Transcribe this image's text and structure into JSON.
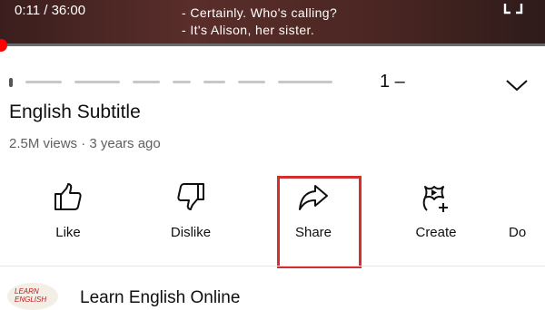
{
  "player": {
    "time_display": "0:11 / 36:00",
    "subtitles": [
      "- Certainly. Who's calling?",
      "- It's Alison, her sister."
    ],
    "progress_fraction": 0.005
  },
  "video": {
    "title_suffix": "1 –",
    "subtitle_line": "English Subtitle",
    "meta": "2.5M views · 3 years ago"
  },
  "actions": [
    {
      "label": "Like",
      "icon": "thumbs-up-icon"
    },
    {
      "label": "Dislike",
      "icon": "thumbs-down-icon"
    },
    {
      "label": "Share",
      "icon": "share-arrow-icon"
    },
    {
      "label": "Create",
      "icon": "create-sparkle-icon"
    },
    {
      "label": "Do",
      "icon": "download-icon"
    }
  ],
  "channel": {
    "name": "Learn English Online",
    "logo_text": "LEARN ENGLISH"
  },
  "colors": {
    "highlight": "#d32f2f",
    "progress": "#ff0000",
    "meta_text": "#606060"
  }
}
